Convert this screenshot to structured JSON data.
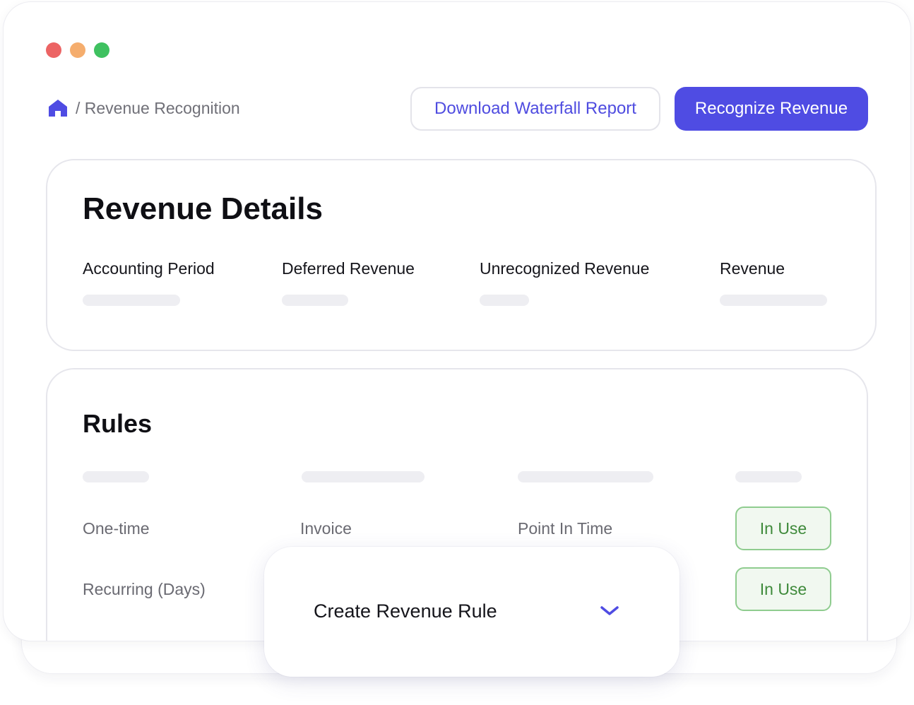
{
  "colors": {
    "accent": "#4f4ce3",
    "close_dot": "#ec6464",
    "minimize_dot": "#f5ad6d",
    "maximize_dot": "#3fc160",
    "badge_green": "#3f8a3b"
  },
  "breadcrumb": {
    "home_icon": "home-icon",
    "current": "/ Revenue Recognition"
  },
  "toolbar": {
    "download_label": "Download Waterfall Report",
    "recognize_label": "Recognize Revenue"
  },
  "details": {
    "title": "Revenue Details",
    "columns": [
      "Accounting Period",
      "Deferred Revenue",
      "Unrecognized Revenue",
      "Revenue"
    ]
  },
  "rules": {
    "title": "Rules",
    "rows": [
      {
        "type": "One-time",
        "trigger": "Invoice",
        "recognition": "Point In Time",
        "status": "In Use"
      },
      {
        "type": "Recurring (Days)",
        "status": "In Use"
      }
    ]
  },
  "popover": {
    "label": "Create Revenue Rule",
    "icon": "chevron-down-icon"
  }
}
